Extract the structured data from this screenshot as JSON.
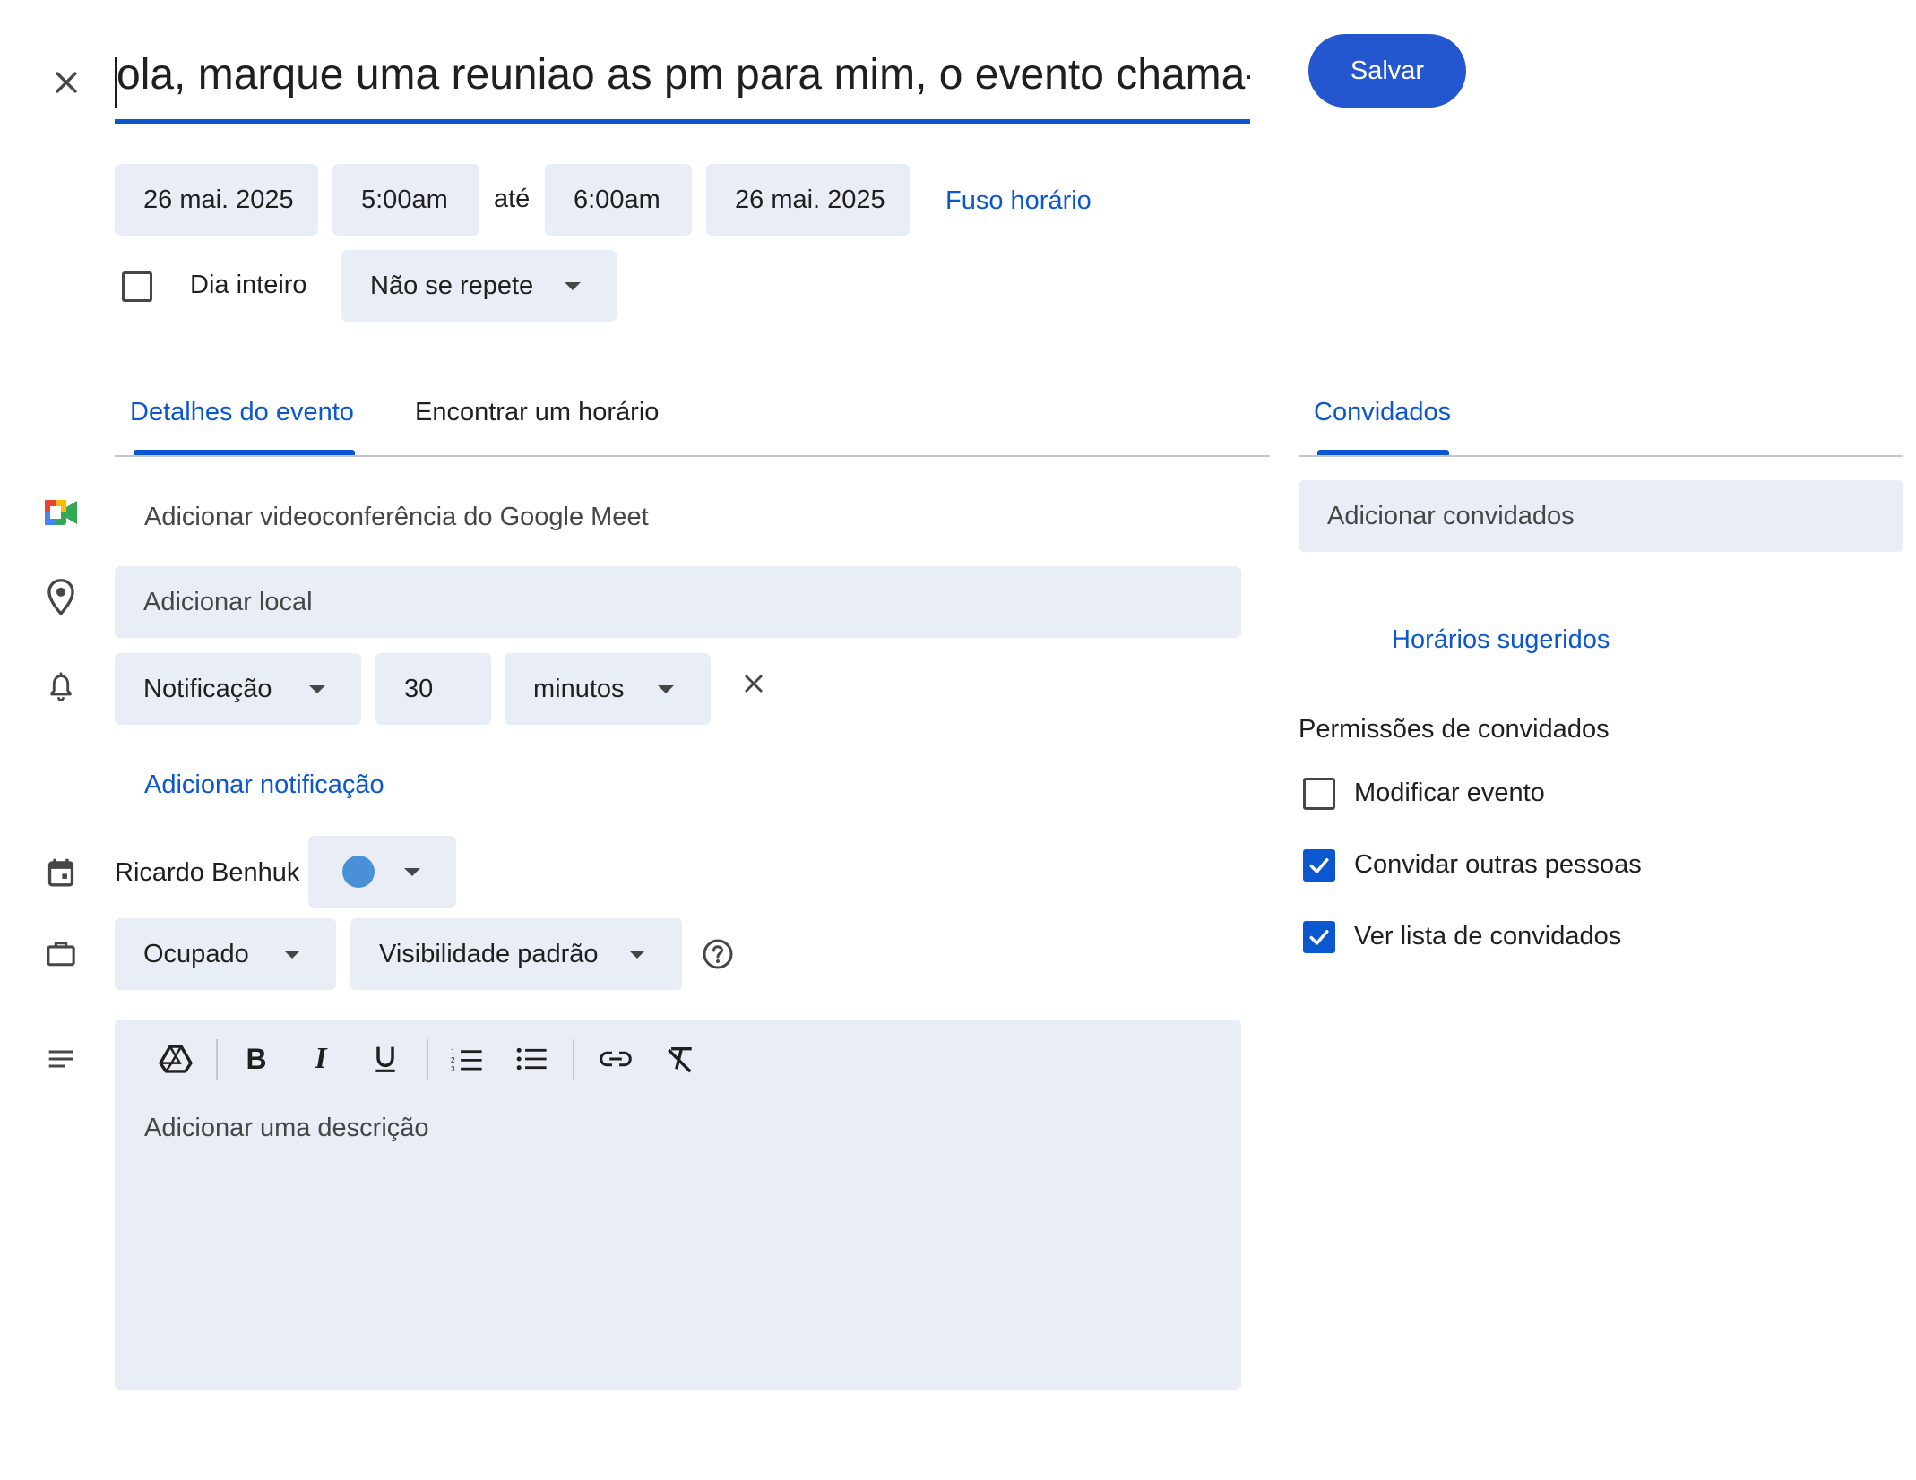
{
  "header": {
    "close_icon": "close-icon",
    "title_value": "ola, marque uma reuniao as pm para mim, o evento chama-",
    "save_label": "Salvar"
  },
  "datetime": {
    "start_date": "26 mai. 2025",
    "start_time": "5:00am",
    "to_label": "até",
    "end_time": "6:00am",
    "end_date": "26 mai. 2025",
    "timezone_label": "Fuso horário",
    "all_day_label": "Dia inteiro",
    "all_day_checked": false,
    "repeat_value": "Não se repete"
  },
  "tabs": {
    "details": "Detalhes do evento",
    "find_time": "Encontrar um horário",
    "guests": "Convidados"
  },
  "details": {
    "meet_label": "Adicionar videoconferência do Google Meet",
    "location_placeholder": "Adicionar local",
    "notification_type": "Notificação",
    "notification_amount": "30",
    "notification_unit": "minutos",
    "add_notification_label": "Adicionar notificação",
    "calendar_owner": "Ricardo Benhuk",
    "calendar_color": "#4a90d9",
    "availability": "Ocupado",
    "visibility": "Visibilidade padrão",
    "description_placeholder": "Adicionar uma descrição",
    "toolbar_icons": [
      "drive-icon",
      "bold-icon",
      "italic-icon",
      "underline-icon",
      "numbered-list-icon",
      "bulleted-list-icon",
      "link-icon",
      "clear-format-icon"
    ]
  },
  "guests": {
    "add_placeholder": "Adicionar convidados",
    "suggested_times_label": "Horários sugeridos",
    "permissions_title": "Permissões de convidados",
    "permissions": [
      {
        "label": "Modificar evento",
        "checked": false
      },
      {
        "label": "Convidar outras pessoas",
        "checked": true
      },
      {
        "label": "Ver lista de convidados",
        "checked": true
      }
    ]
  },
  "colors": {
    "accent": "#0b57d0",
    "chip_bg": "#e9eef6",
    "save_bg": "#2456d0"
  }
}
